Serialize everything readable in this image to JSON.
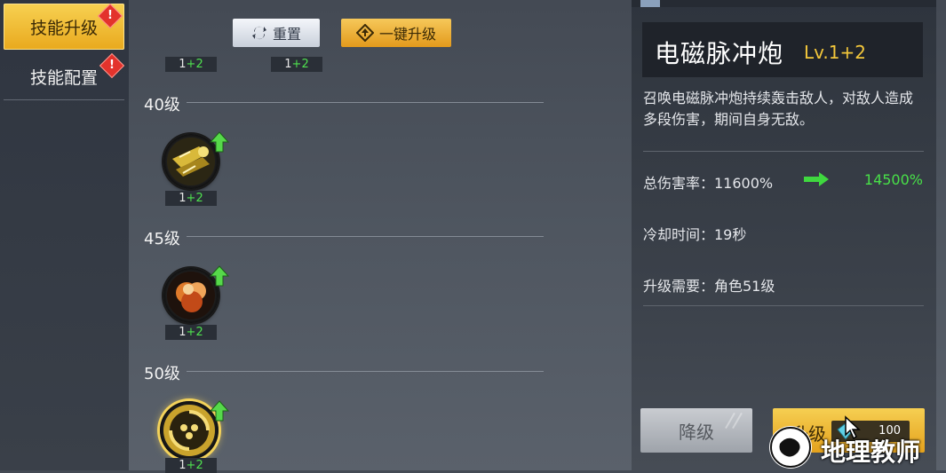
{
  "sidebar": {
    "items": [
      {
        "label": "技能升级",
        "active": true,
        "alert": "!"
      },
      {
        "label": "技能配置",
        "active": false,
        "alert": "!"
      }
    ]
  },
  "toolbar": {
    "reset_label": "重置",
    "one_click_label": "一键升级"
  },
  "top_level_tags": [
    {
      "base": "1",
      "bonus": "+2"
    },
    {
      "base": "1",
      "bonus": "+2"
    }
  ],
  "skill_tiers": [
    {
      "label": "40级",
      "skill": {
        "icon": "electric-cannon-icon",
        "base": "1",
        "bonus": "+2",
        "upgradable": true
      }
    },
    {
      "label": "45级",
      "skill": {
        "icon": "fire-explosion-icon",
        "base": "1",
        "bonus": "+2",
        "upgradable": true
      }
    },
    {
      "label": "50级",
      "skill": {
        "icon": "vortex-icon",
        "base": "1",
        "bonus": "+2",
        "upgradable": true
      }
    }
  ],
  "detail": {
    "name": "电磁脉冲炮",
    "level_prefix": "Lv.1",
    "level_bonus": "+2",
    "description": "召唤电磁脉冲炮持续轰击敌人，对敌人造成多段伤害，期间自身无敌。",
    "damage_label": "总伤害率：11600%",
    "damage_new": "14500%",
    "cooldown_label": "冷却时间：19秒",
    "requirement_label": "升级需要：角色51级"
  },
  "actions": {
    "downgrade_label": "降级",
    "upgrade_label": "升级",
    "cost_value": "100"
  },
  "watermark": {
    "text": "地理教师"
  },
  "colors": {
    "accent": "#f3c73b",
    "positive": "#48e048",
    "alert": "#e3332c"
  }
}
